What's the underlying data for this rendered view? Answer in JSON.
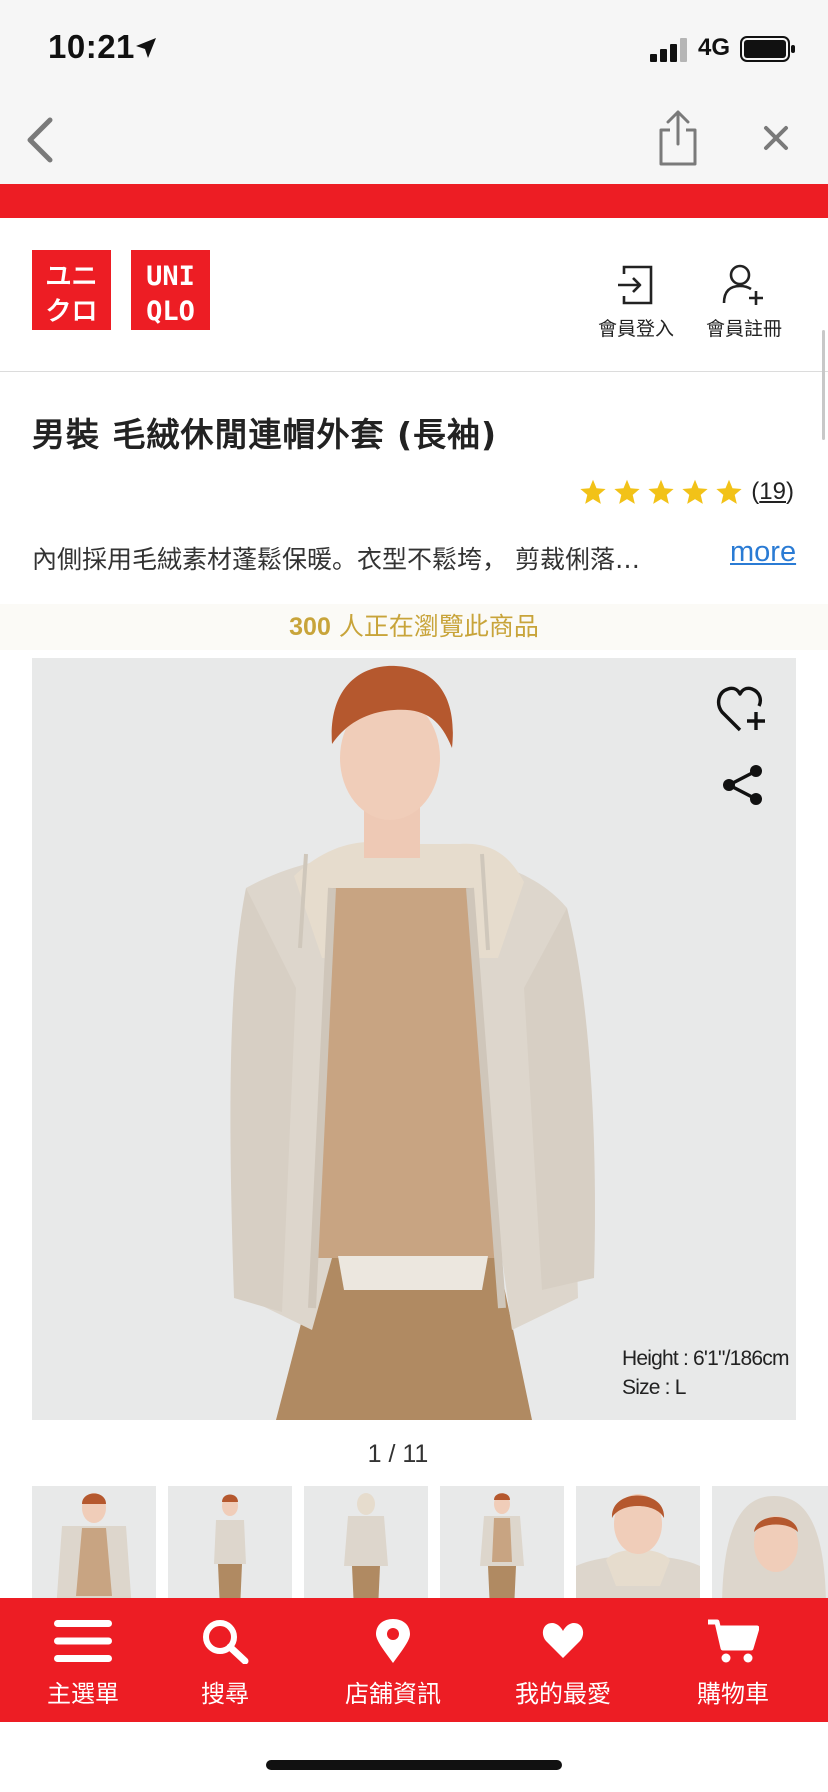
{
  "status_bar": {
    "time": "10:21",
    "network": "4G",
    "icons": [
      "location-arrow-icon",
      "signal-icon",
      "battery-icon"
    ]
  },
  "nav_bar": {
    "icons": [
      "back-chevron-icon",
      "share-icon",
      "close-icon"
    ]
  },
  "header": {
    "logo_left": [
      "ユニ",
      "クロ"
    ],
    "logo_right": [
      "UNI",
      "QLO"
    ],
    "login_label": "會員登入",
    "register_label": "會員註冊"
  },
  "product": {
    "title": "男裝 毛絨休閒連帽外套 (長袖)",
    "rating_stars": 5,
    "review_count": "19",
    "description": "內側採用毛絨素材蓬鬆保暖。衣型不鬆垮， 剪裁俐落…",
    "more_label": "more",
    "viewers_count": "300",
    "viewers_text": " 人正在瀏覽此商品",
    "model_height": "Height : 6'1\"/186cm",
    "model_size": "Size : L",
    "image_pager": "1 / 11",
    "thumbnail_count": 6
  },
  "tab_bar": {
    "items": [
      {
        "label": "主選單",
        "icon": "menu-icon"
      },
      {
        "label": "搜尋",
        "icon": "search-icon"
      },
      {
        "label": "店舖資訊",
        "icon": "location-pin-icon"
      },
      {
        "label": "我的最愛",
        "icon": "heart-icon"
      },
      {
        "label": "購物車",
        "icon": "cart-icon"
      }
    ]
  },
  "colors": {
    "brand_red": "#ed1d24",
    "star_gold": "#f2c218",
    "viewers_gold": "#c8a43a",
    "link_blue": "#2a7bd4"
  }
}
